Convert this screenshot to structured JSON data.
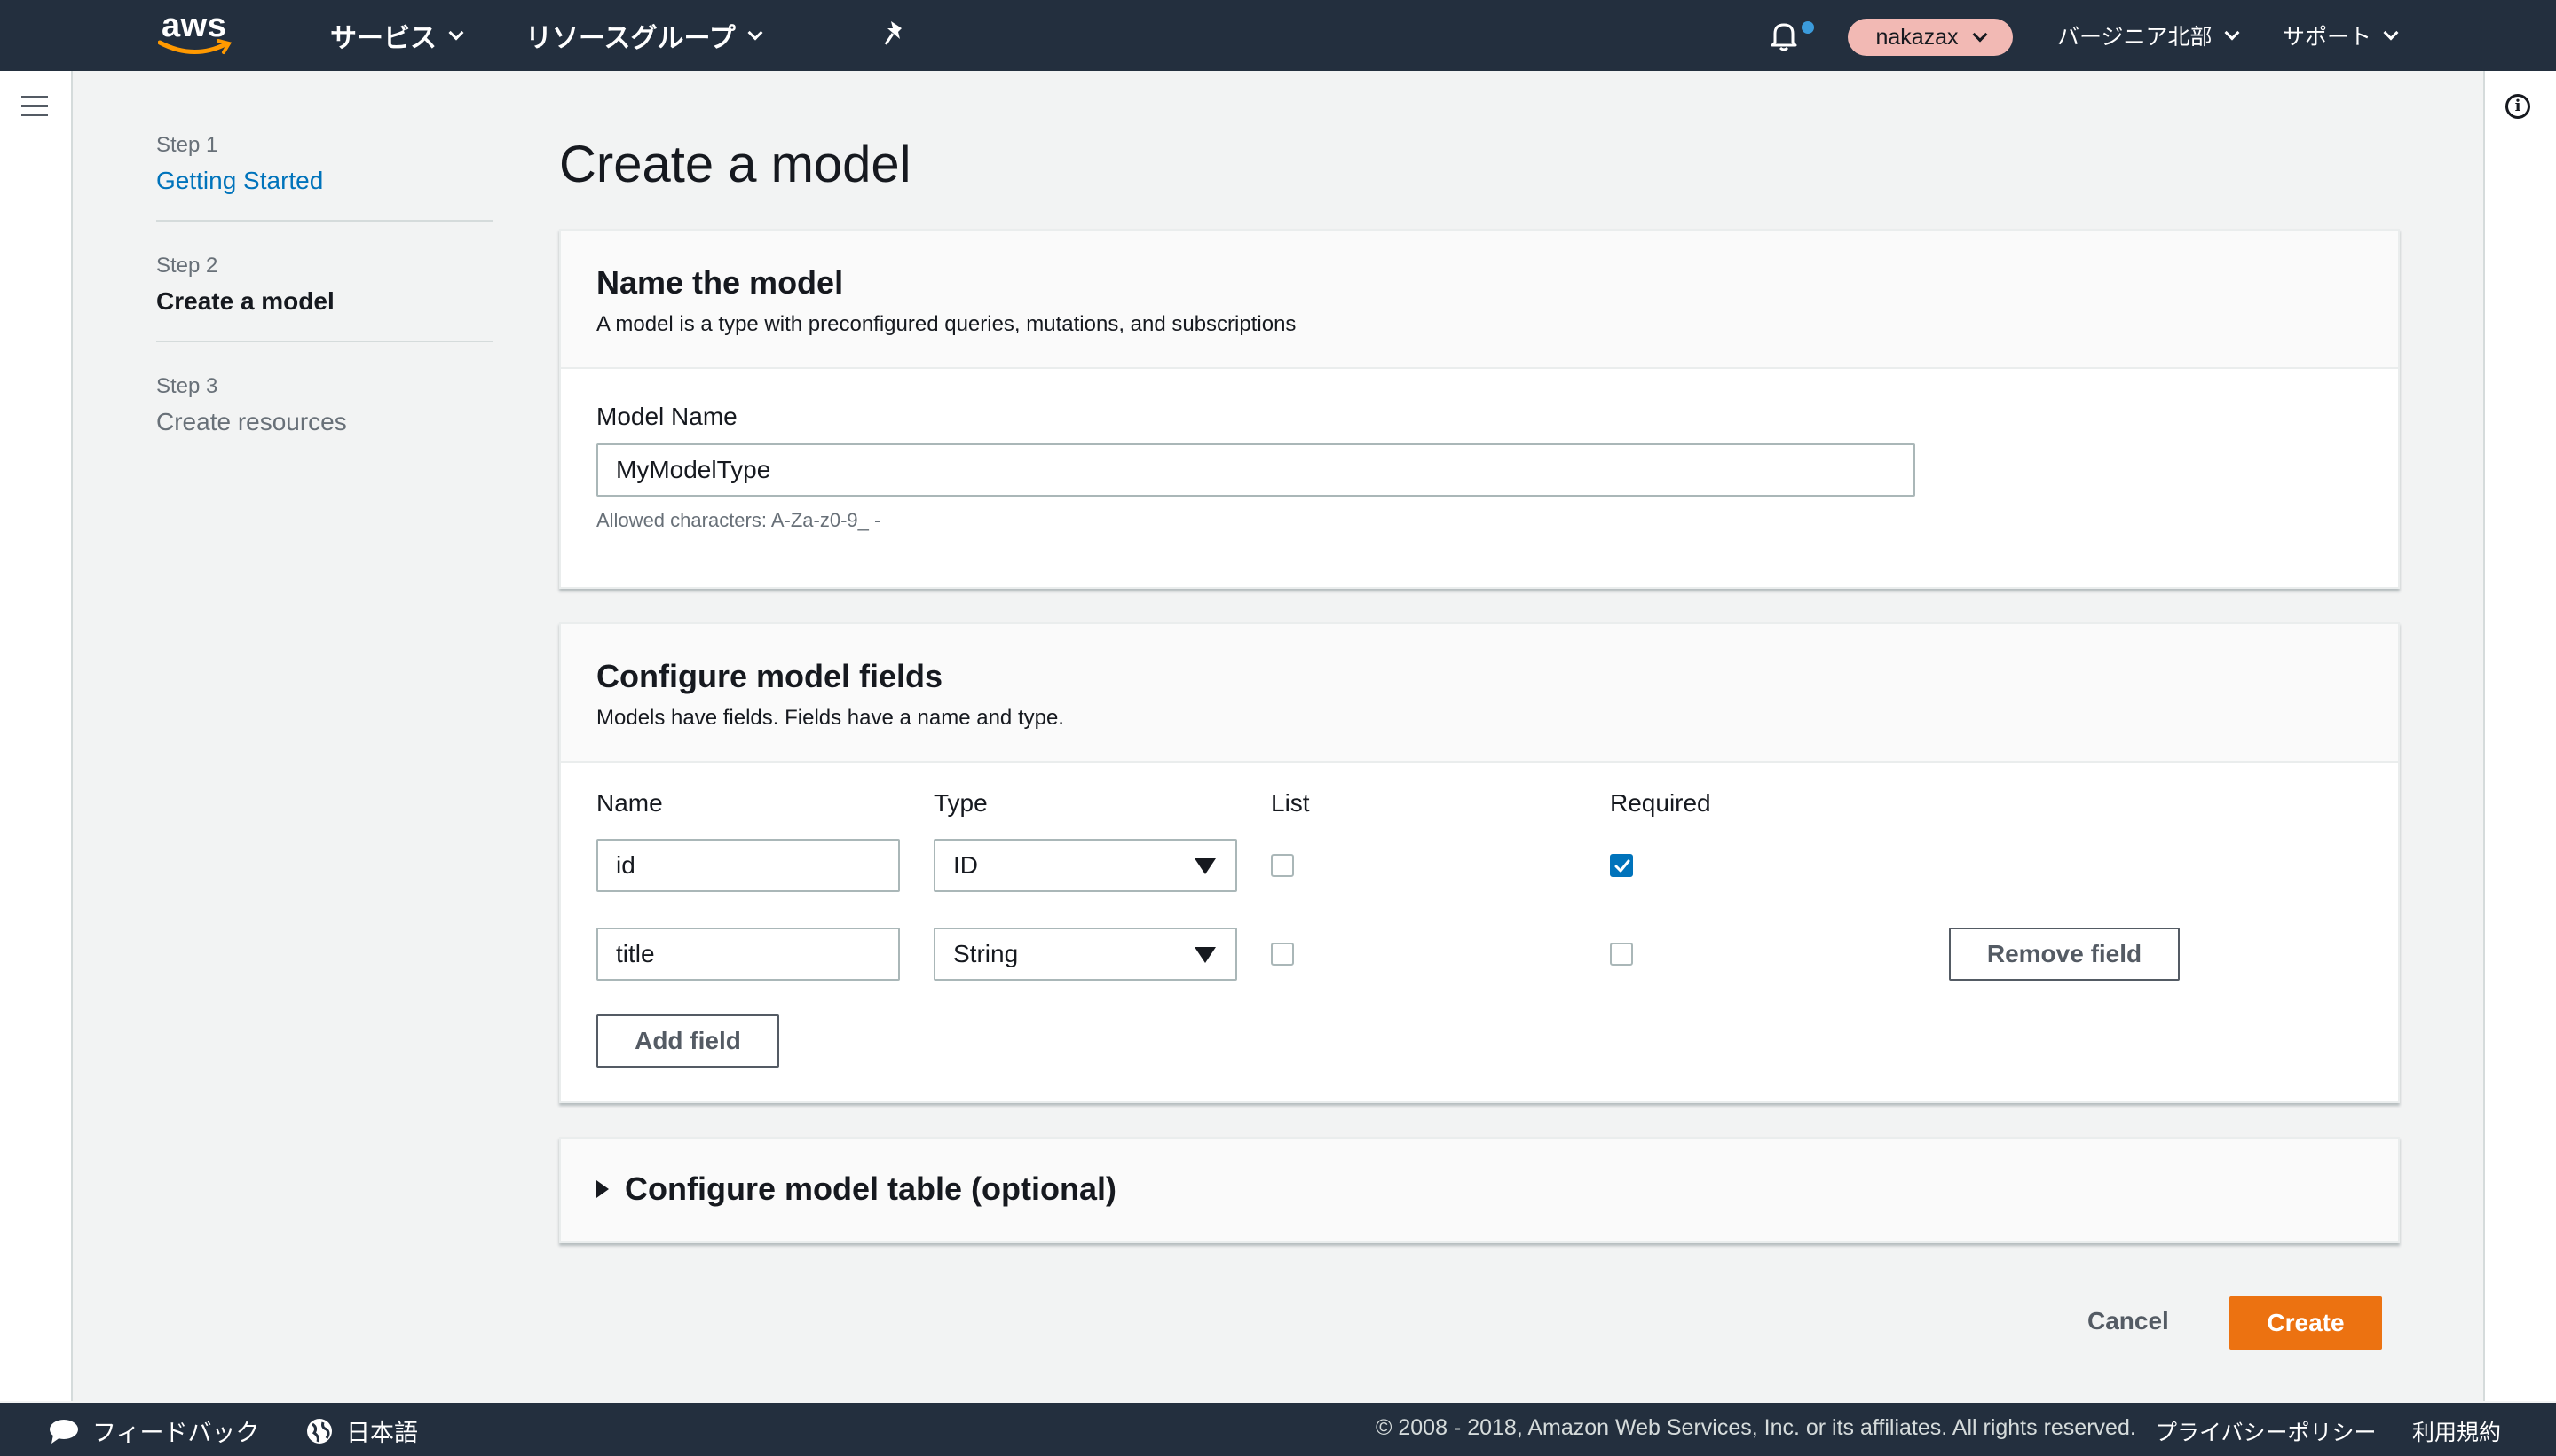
{
  "topnav": {
    "logo": "aws",
    "services": "サービス",
    "resource_groups": "リソースグループ",
    "account": "nakazax",
    "region": "バージニア北部",
    "support": "サポート"
  },
  "steps": [
    {
      "num": "Step 1",
      "title": "Getting Started"
    },
    {
      "num": "Step 2",
      "title": "Create a model"
    },
    {
      "num": "Step 3",
      "title": "Create resources"
    }
  ],
  "page_title": "Create a model",
  "name_panel": {
    "title": "Name the model",
    "description": "A model is a type with preconfigured queries, mutations, and subscriptions",
    "field_label": "Model Name",
    "field_value": "MyModelType",
    "hint": "Allowed characters: A-Za-z0-9_ -"
  },
  "fields_panel": {
    "title": "Configure model fields",
    "description": "Models have fields. Fields have a name and type.",
    "columns": {
      "name": "Name",
      "type": "Type",
      "list": "List",
      "required": "Required"
    },
    "rows": [
      {
        "name": "id",
        "type": "ID",
        "list": false,
        "required": true
      },
      {
        "name": "title",
        "type": "String",
        "list": false,
        "required": false
      }
    ],
    "remove_button": "Remove field",
    "add_button": "Add field"
  },
  "table_panel": {
    "title": "Configure model table (optional)"
  },
  "actions": {
    "cancel": "Cancel",
    "create": "Create"
  },
  "footer": {
    "feedback": "フィードバック",
    "language": "日本語",
    "copyright": "© 2008 - 2018, Amazon Web Services, Inc. or its affiliates. All rights reserved.",
    "privacy": "プライバシーポリシー",
    "terms": "利用規約"
  },
  "colors": {
    "nav_bg": "#232f3e",
    "primary": "#ec7211",
    "link": "#0073bb",
    "account_pill": "#f2b9b4"
  }
}
